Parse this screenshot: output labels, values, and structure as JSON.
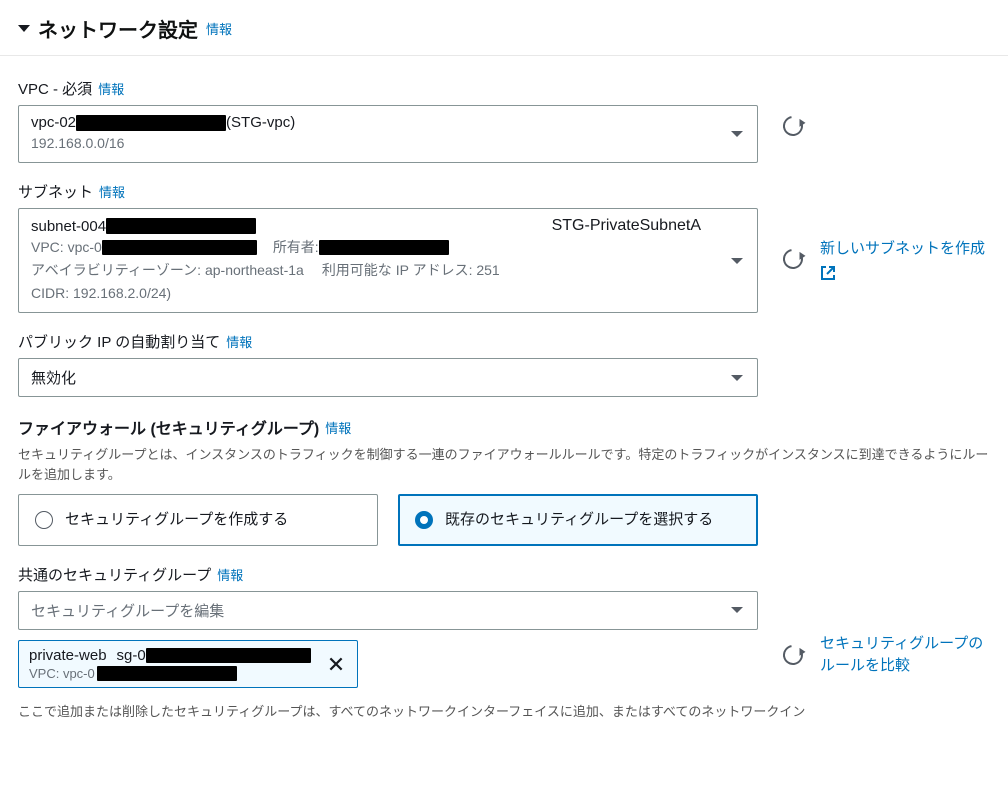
{
  "panel": {
    "title": "ネットワーク設定",
    "info": "情報"
  },
  "vpc": {
    "label": "VPC - 必須",
    "info": "情報",
    "value_prefix": "vpc-02",
    "value_suffix": " (STG-vpc)",
    "cidr": "192.168.0.0/16"
  },
  "subnet": {
    "label": "サブネット",
    "info": "情報",
    "value_prefix": "subnet-004",
    "right_name": "STG-PrivateSubnetA",
    "vpc_label": "VPC: vpc-0",
    "owner_label": "所有者: ",
    "az_label": "アベイラビリティーゾーン: ap-northeast-1a",
    "avail_ip_label": "利用可能な IP アドレス: 251",
    "cidr_label": "CIDR: 192.168.2.0/24)",
    "create_link": "新しいサブネットを作成"
  },
  "autoip": {
    "label": "パブリック IP の自動割り当て",
    "info": "情報",
    "value": "無効化"
  },
  "firewall": {
    "label": "ファイアウォール (セキュリティグループ)",
    "info": "情報",
    "desc": "セキュリティグループとは、インスタンスのトラフィックを制御する一連のファイアウォールルールです。特定のトラフィックがインスタンスに到達できるようにルールを追加します。",
    "radio_create": "セキュリティグループを作成する",
    "radio_existing": "既存のセキュリティグループを選択する"
  },
  "sg": {
    "label": "共通のセキュリティグループ",
    "info": "情報",
    "placeholder": "セキュリティグループを編集",
    "chip_name": "private-web",
    "chip_sgid": "sg-0",
    "chip_vpc": "VPC: vpc-0",
    "compare_link": "セキュリティグループのルールを比較"
  },
  "footer_text": "ここで追加または削除したセキュリティグループは、すべてのネットワークインターフェイスに追加、またはすべてのネットワークイン"
}
